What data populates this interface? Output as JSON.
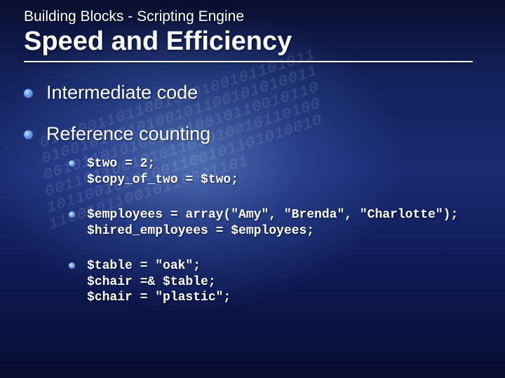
{
  "superhead": "Building Blocks - Scripting Engine",
  "title": "Speed and Efficiency",
  "bullets": {
    "b1": "Intermediate code",
    "b2": "Reference counting"
  },
  "code": {
    "c1": "$two = 2;\n$copy_of_two = $two;",
    "c2": "$employees = array(\"Amy\", \"Brenda\", \"Charlotte\");\n$hired_employees = $employees;",
    "c3": "$table = \"oak\";\n$chair =& $table;\n$chair = \"plastic\";"
  },
  "bg_digits": "0101001101100101010010110101101001011010100101100101010011001011010100101100101100101100011011001010110101001011010010110010101001100101101010010110010110010110001101"
}
